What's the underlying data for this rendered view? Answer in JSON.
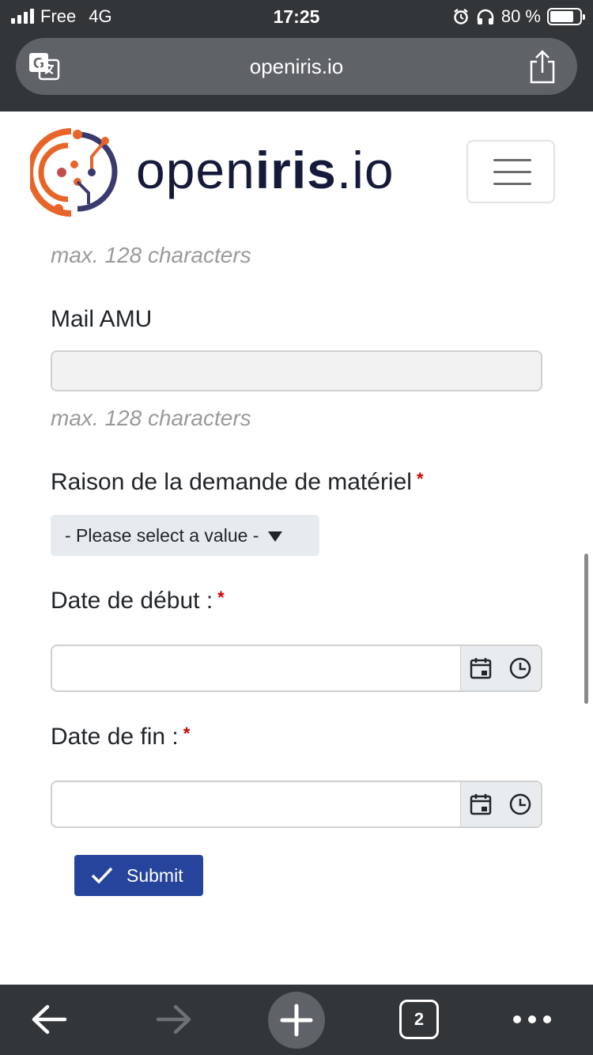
{
  "status_bar": {
    "carrier": "Free",
    "network": "4G",
    "time": "17:25",
    "battery": "80 %",
    "battery_level": 0.8
  },
  "browser": {
    "url": "openiris.io",
    "tab_count": "2",
    "toolbar_icons": [
      "back-arrow-icon",
      "forward-arrow-icon",
      "plus-icon",
      "tabs-icon",
      "more-icon"
    ]
  },
  "site": {
    "logo_text_light": "open",
    "logo_text_bold": "iris",
    "logo_text_suffix": ".io"
  },
  "form": {
    "help_top": "max. 128 characters",
    "mail_label": "Mail AMU",
    "mail_value": "",
    "mail_help": "max. 128 characters",
    "reason_label": "Raison de la demande de matériel",
    "reason_select": "- Please select a value -",
    "start_label": "Date de début :",
    "start_value": "",
    "end_label": "Date de fin :",
    "end_value": "",
    "required_mark": "*",
    "submit_label": "Submit"
  },
  "colors": {
    "chrome": "#323639",
    "url_bar": "#5f6368",
    "submit": "#27449c",
    "required": "#d00000",
    "logo_orange": "#e8652a",
    "logo_navy": "#151a3a"
  }
}
